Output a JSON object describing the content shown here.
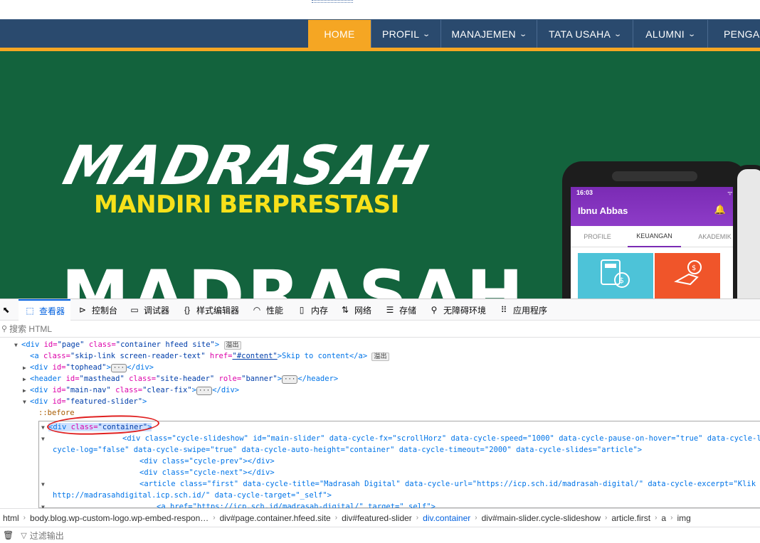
{
  "nav": {
    "items": [
      {
        "label": "HOME"
      },
      {
        "label": "PROFIL"
      },
      {
        "label": "MANAJEMEN"
      },
      {
        "label": "TATA USAHA"
      },
      {
        "label": "ALUMNI"
      },
      {
        "label": "PENGAD"
      }
    ]
  },
  "hero": {
    "title": "MADRASAH",
    "subtitle": "MANDIRI BERPRESTASI",
    "title2": "MADRASAH",
    "phone": {
      "time": "16:03",
      "status": "ᯤ ▮",
      "user": "Ibnu Abbas",
      "tabs": [
        "PROFILE",
        "KEUANGAN",
        "AKADEMIK"
      ]
    }
  },
  "devtools": {
    "tabs": [
      {
        "label": "查看器",
        "icon": "inspector-icon"
      },
      {
        "label": "控制台",
        "icon": "console-icon"
      },
      {
        "label": "调试器",
        "icon": "debugger-icon"
      },
      {
        "label": "样式编辑器",
        "icon": "style-editor-icon"
      },
      {
        "label": "性能",
        "icon": "performance-icon"
      },
      {
        "label": "内存",
        "icon": "memory-icon"
      },
      {
        "label": "网络",
        "icon": "network-icon"
      },
      {
        "label": "存储",
        "icon": "storage-icon"
      },
      {
        "label": "无障碍环境",
        "icon": "accessibility-icon"
      },
      {
        "label": "应用程序",
        "icon": "application-icon"
      }
    ],
    "search_placeholder": "搜索 HTML",
    "tree": {
      "r1_open": "<div ",
      "r1_a1": "id=",
      "r1_v1": "\"page\"",
      "r1_a2": " class=",
      "r1_v2": "\"container hfeed site\"",
      "r1_close": ">",
      "r1_badge": "溢出",
      "r2_open": "<a ",
      "r2_a1": "class=",
      "r2_v1": "\"skip-link screen-reader-text\"",
      "r2_a2": " href=",
      "r2_v2": "\"#content\"",
      "r2_text": ">Skip to content</a>",
      "r2_badge": "溢出",
      "r3_open": "<div ",
      "r3_a1": "id=",
      "r3_v1": "\"tophead\"",
      "r3_close": ">",
      "r3_end": "</div>",
      "r4_open": "<header ",
      "r4_a1": "id=",
      "r4_v1": "\"masthead\"",
      "r4_a2": " class=",
      "r4_v2": "\"site-header\"",
      "r4_a3": " role=",
      "r4_v3": "\"banner\"",
      "r4_close": ">",
      "r4_end": "</header>",
      "r5_open": "<div ",
      "r5_a1": "id=",
      "r5_v1": "\"main-nav\"",
      "r5_a2": " class=",
      "r5_v2": "\"clear-fix\"",
      "r5_close": ">",
      "r5_end": "</div>",
      "r6_open": "<div ",
      "r6_a1": "id=",
      "r6_v1": "\"featured-slider\"",
      "r6_close": ">",
      "r7_pseudo": "::before",
      "r8_open": "<div ",
      "r8_a1": "class=",
      "r8_v1": "\"container\"",
      "r8_close": ">",
      "r9": "<div class=\"cycle-slideshow\" id=\"main-slider\" data-cycle-fx=\"scrollHorz\" data-cycle-speed=\"1000\" data-cycle-pause-on-hover=\"true\" data-cycle-loader=\"f",
      "r10": "cycle-log=\"false\" data-cycle-swipe=\"true\" data-cycle-auto-height=\"container\" data-cycle-timeout=\"2000\" data-cycle-slides=\"article\">",
      "r11": "<div class=\"cycle-prev\"></div>",
      "r12": "<div class=\"cycle-next\"></div>",
      "r13": "<article class=\"first\" data-cycle-title=\"Madrasah Digital\" data-cycle-url=\"https://icp.sch.id/madrasah-digital/\" data-cycle-excerpt=\"Klik Disini",
      "r14": "http://madrasahdigital.icp.sch.id/\" data-cycle-target=\"_self\">",
      "r15": "<a href=\"https://icp.sch.id/madrasah-digital/\" target=\"_self\">"
    },
    "breadcrumbs": [
      "html",
      "body.blog.wp-custom-logo.wp-embed-respon…",
      "div#page.container.hfeed.site",
      "div#featured-slider",
      "div.container",
      "div#main-slider.cycle-slideshow",
      "article.first",
      "a",
      "img"
    ],
    "console_filter": "过滤输出"
  }
}
